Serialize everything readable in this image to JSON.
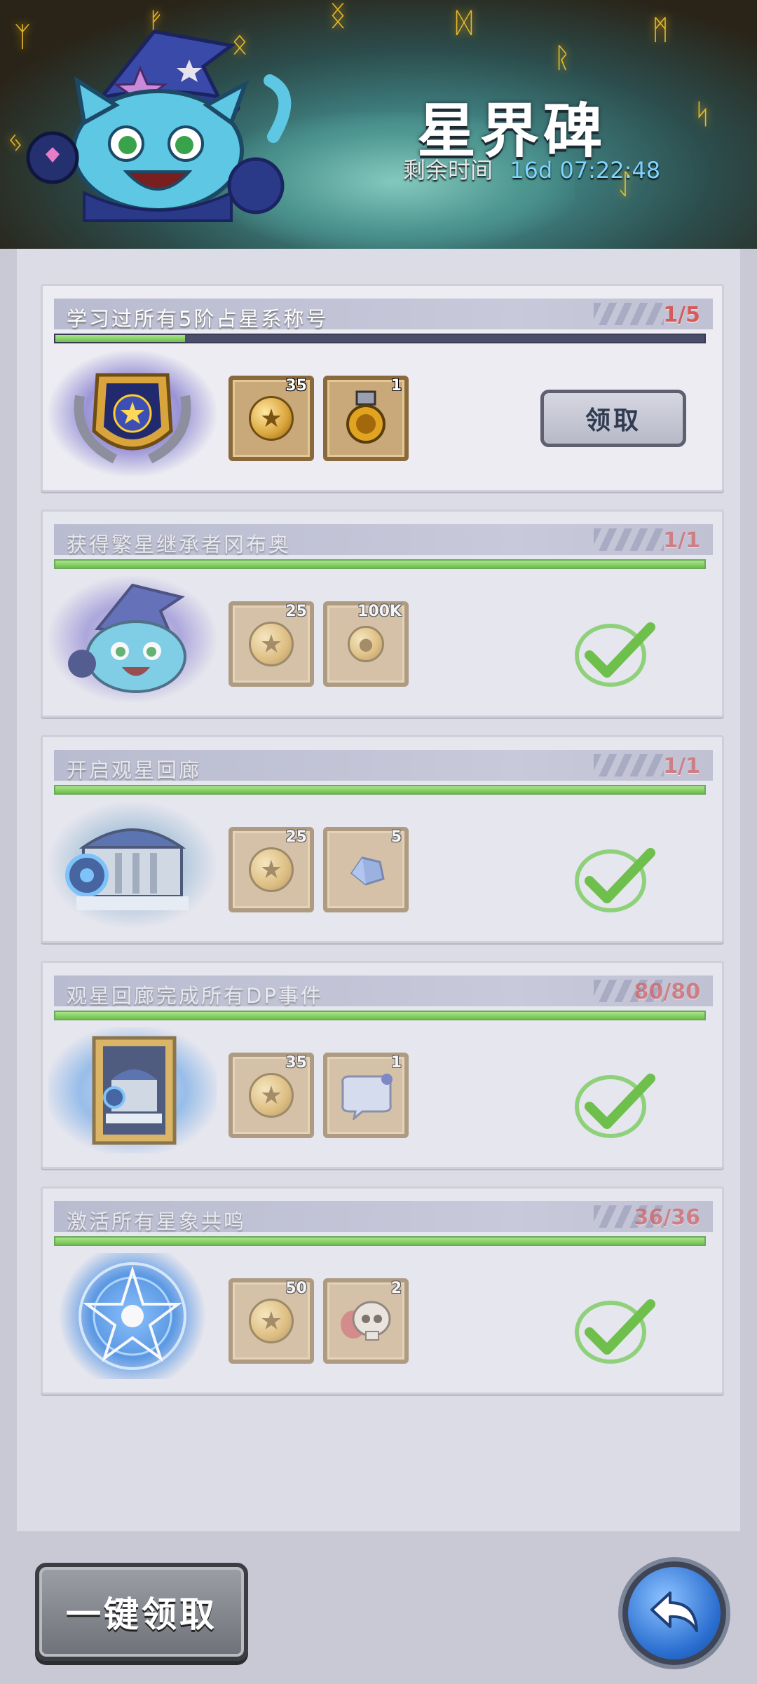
{
  "header": {
    "title": "星界碑",
    "timer_label": "剩余时间",
    "timer_value": "16d 07:22:48"
  },
  "tasks": [
    {
      "name": "学习过所有5阶占星系称号",
      "progress_text": "1/5",
      "progress": 0.2,
      "status": "claimable",
      "claim_label": "领取",
      "rewards": [
        {
          "icon": "star-coin-icon",
          "count": "35"
        },
        {
          "icon": "medal-icon",
          "count": "1"
        }
      ]
    },
    {
      "name": "获得繁星继承者冈布奥",
      "progress_text": "1/1",
      "progress": 1,
      "status": "completed",
      "rewards": [
        {
          "icon": "star-coin-icon",
          "count": "25"
        },
        {
          "icon": "gold-coin-icon",
          "count": "100K"
        }
      ]
    },
    {
      "name": "开启观星回廊",
      "progress_text": "1/1",
      "progress": 1,
      "status": "completed",
      "rewards": [
        {
          "icon": "star-coin-icon",
          "count": "25"
        },
        {
          "icon": "crystal-icon",
          "count": "5"
        }
      ]
    },
    {
      "name": "观星回廊完成所有DP事件",
      "progress_text": "80/80",
      "progress": 1,
      "status": "completed",
      "rewards": [
        {
          "icon": "star-coin-icon",
          "count": "35"
        },
        {
          "icon": "speech-bubble-frame-icon",
          "count": "1"
        }
      ]
    },
    {
      "name": "激活所有星象共鸣",
      "progress_text": "36/36",
      "progress": 1,
      "status": "completed",
      "rewards": [
        {
          "icon": "star-coin-icon",
          "count": "50"
        },
        {
          "icon": "skull-icon",
          "count": "2"
        }
      ]
    }
  ],
  "footer": {
    "claim_all_label": "一键领取",
    "back_icon": "back-arrow-icon"
  },
  "colors": {
    "progress_red": "#d55b5b",
    "bar_green": "#7fc56a",
    "timer_blue": "#7fd4ff"
  }
}
